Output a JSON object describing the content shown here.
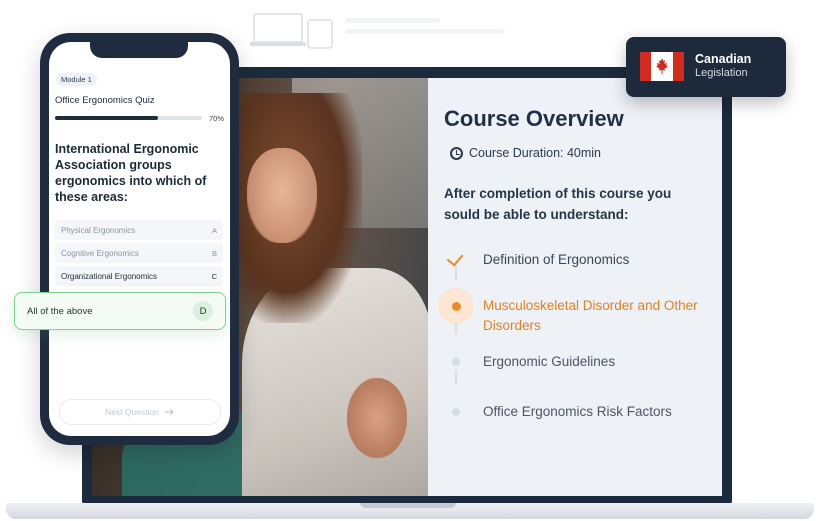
{
  "course": {
    "title": "Course Overview",
    "duration": "Course Duration: 40min",
    "intro": "After completion of this course you sould be able to understand:",
    "topics": [
      {
        "label": "Definition of Ergonomics",
        "state": "done"
      },
      {
        "label": "Musculoskeletal Disorder and Other Disorders",
        "state": "active"
      },
      {
        "label": "Ergonomic Guidelines",
        "state": "pending"
      },
      {
        "label": "Office Ergonomics Risk Factors",
        "state": "pending"
      }
    ],
    "accent_color": "#f08a23",
    "title_color": "#1f3047"
  },
  "badge": {
    "title": "Canadian",
    "subtitle": "Legislation",
    "icon": "canada-flag-icon"
  },
  "quiz": {
    "module": "Module 1",
    "title": "Office Ergonomics Quiz",
    "progress_percent": 70,
    "progress_label": "70%",
    "question": "International Ergonomic Association groups ergonomics into which of these areas:",
    "options": [
      {
        "text": "Physical Ergonomics",
        "key": "A"
      },
      {
        "text": "Cognitive Ergonomics",
        "key": "B"
      },
      {
        "text": "Organizational Ergonomics",
        "key": "C"
      },
      {
        "text": "All of the above",
        "key": "D"
      }
    ],
    "selected_key": "D",
    "next_button": "Next Question",
    "selected_color": "#7fd28e"
  },
  "icons": [
    "clock-icon",
    "check-icon",
    "arrow-right-icon",
    "canada-flag-icon"
  ]
}
